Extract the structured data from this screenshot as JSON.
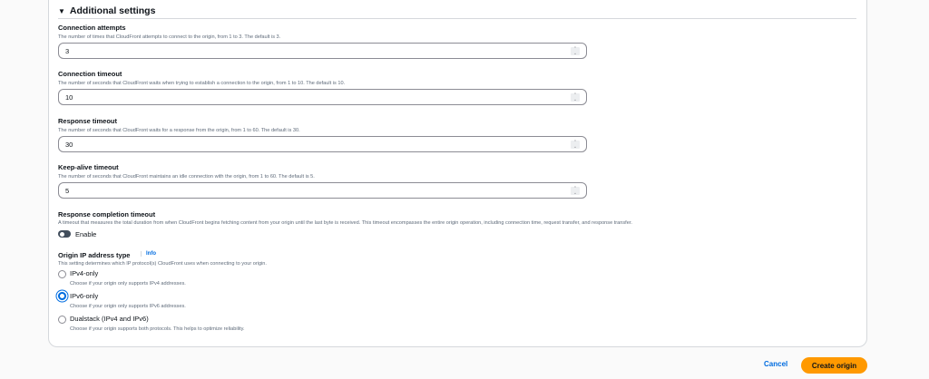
{
  "section": {
    "title": "Additional settings"
  },
  "fields": [
    {
      "label": "Connection attempts",
      "description": "The number of times that CloudFront attempts to connect to the origin, from 1 to 3. The default is 3.",
      "value": "3"
    },
    {
      "label": "Connection timeout",
      "description": "The number of seconds that CloudFront waits when trying to establish a connection to the origin, from 1 to 10. The default is 10.",
      "value": "10"
    },
    {
      "label": "Response timeout",
      "description": "The number of seconds that CloudFront waits for a response from the origin, from 1 to 60. The default is 30.",
      "value": "30"
    },
    {
      "label": "Keep-alive timeout",
      "description": "The number of seconds that CloudFront maintains an idle connection with the origin, from 1 to 60. The default is 5.",
      "value": "5"
    }
  ],
  "completion": {
    "label": "Response completion timeout",
    "description": "A timeout that measures the total duration from when CloudFront begins fetching content from your origin until the last byte is received. This timeout encompasses the entire origin operation, including connection time, request transfer, and response transfer.",
    "toggle_label": "Enable",
    "enabled": false
  },
  "ip_type": {
    "label": "Origin IP address type",
    "info": "Info",
    "description": "This setting determines which IP protocol(s) CloudFront uses when connecting to your origin.",
    "selected": "IPv6-only",
    "options": [
      {
        "label": "IPv4-only",
        "description": "Choose if your origin only supports IPv4 addresses."
      },
      {
        "label": "IPv6-only",
        "description": "Choose if your origin only supports IPv6 addresses."
      },
      {
        "label": "Dualstack (IPv4 and IPv6)",
        "description": "Choose if your origin supports both protocols. This helps to optimize reliability."
      }
    ]
  },
  "actions": {
    "cancel": "Cancel",
    "create": "Create origin"
  },
  "colors": {
    "primary": "#ff9900",
    "link": "#006ce0"
  }
}
